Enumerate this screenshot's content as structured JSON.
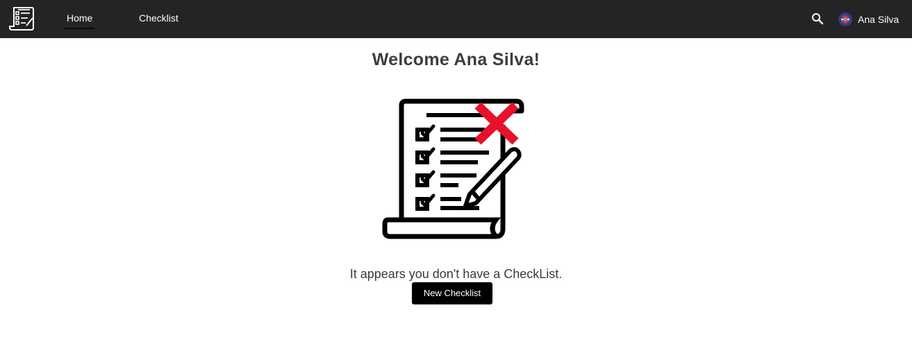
{
  "app": {
    "logo_icon": "checklist-scroll-icon"
  },
  "nav": {
    "items": [
      {
        "label": "Home",
        "active": true
      },
      {
        "label": "Checklist",
        "active": false
      }
    ],
    "search_icon": "search-icon",
    "user": {
      "name": "Ana Silva",
      "avatar_icon": "user-avatar"
    }
  },
  "main": {
    "welcome": "Welcome Ana Silva!",
    "illustration_icon": "empty-checklist-icon",
    "empty_message": "It appears you don't have a CheckList.",
    "new_button_label": "New Checklist"
  },
  "colors": {
    "navbar_bg": "#242424",
    "accent_red": "#e8102a",
    "button_bg": "#000000"
  }
}
